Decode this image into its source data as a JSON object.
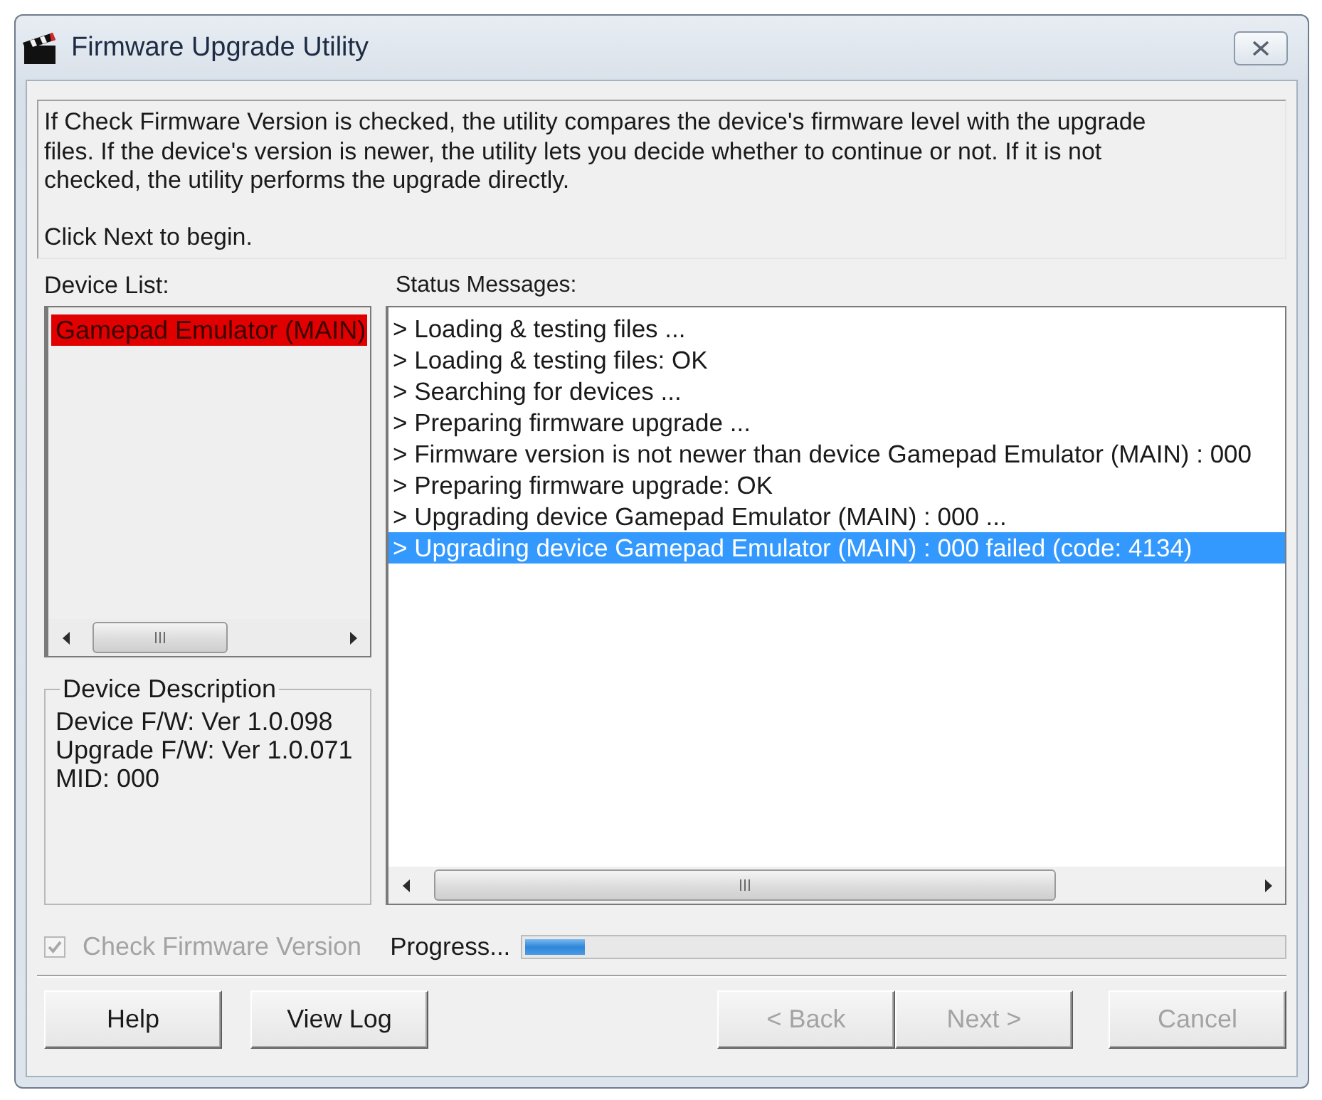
{
  "window": {
    "title": "Firmware Upgrade Utility"
  },
  "info": {
    "paragraph": "If Check Firmware Version is checked, the utility compares the device's firmware level with the upgrade files. If the device's version is newer, the utility lets you decide whether to continue or not. If it is not checked, the utility performs the upgrade directly.",
    "hint": "Click Next to begin."
  },
  "device_list": {
    "label": "Device List:",
    "items": [
      {
        "name": "Gamepad Emulator (MAIN)",
        "selected": true
      }
    ]
  },
  "device_description": {
    "title": "Device Description",
    "lines": [
      "Device F/W: Ver 1.0.098",
      "Upgrade F/W: Ver 1.0.071",
      "MID: 000"
    ]
  },
  "status_messages": {
    "label": "Status Messages:",
    "items": [
      {
        "text": "> Loading & testing files ...",
        "selected": false
      },
      {
        "text": "> Loading & testing files: OK",
        "selected": false
      },
      {
        "text": "> Searching for devices ...",
        "selected": false
      },
      {
        "text": "> Preparing firmware upgrade ...",
        "selected": false
      },
      {
        "text": "> Firmware version is not newer than device Gamepad Emulator (MAIN) : 000",
        "selected": false
      },
      {
        "text": "> Preparing firmware upgrade: OK",
        "selected": false
      },
      {
        "text": "> Upgrading device Gamepad Emulator (MAIN) : 000 ...",
        "selected": false
      },
      {
        "text": "> Upgrading device Gamepad Emulator (MAIN) : 000 failed (code: 4134)",
        "selected": true
      }
    ]
  },
  "check_firmware": {
    "label": "Check Firmware Version",
    "checked": true,
    "disabled": true
  },
  "progress": {
    "label": "Progress...",
    "level": 0.08
  },
  "buttons": [
    {
      "label": "Help",
      "disabled": false
    },
    {
      "label": "View Log",
      "disabled": false
    },
    {
      "label": "< Back",
      "disabled": true
    },
    {
      "label": "Next >",
      "disabled": true
    },
    {
      "label": "Cancel",
      "disabled": true
    }
  ]
}
